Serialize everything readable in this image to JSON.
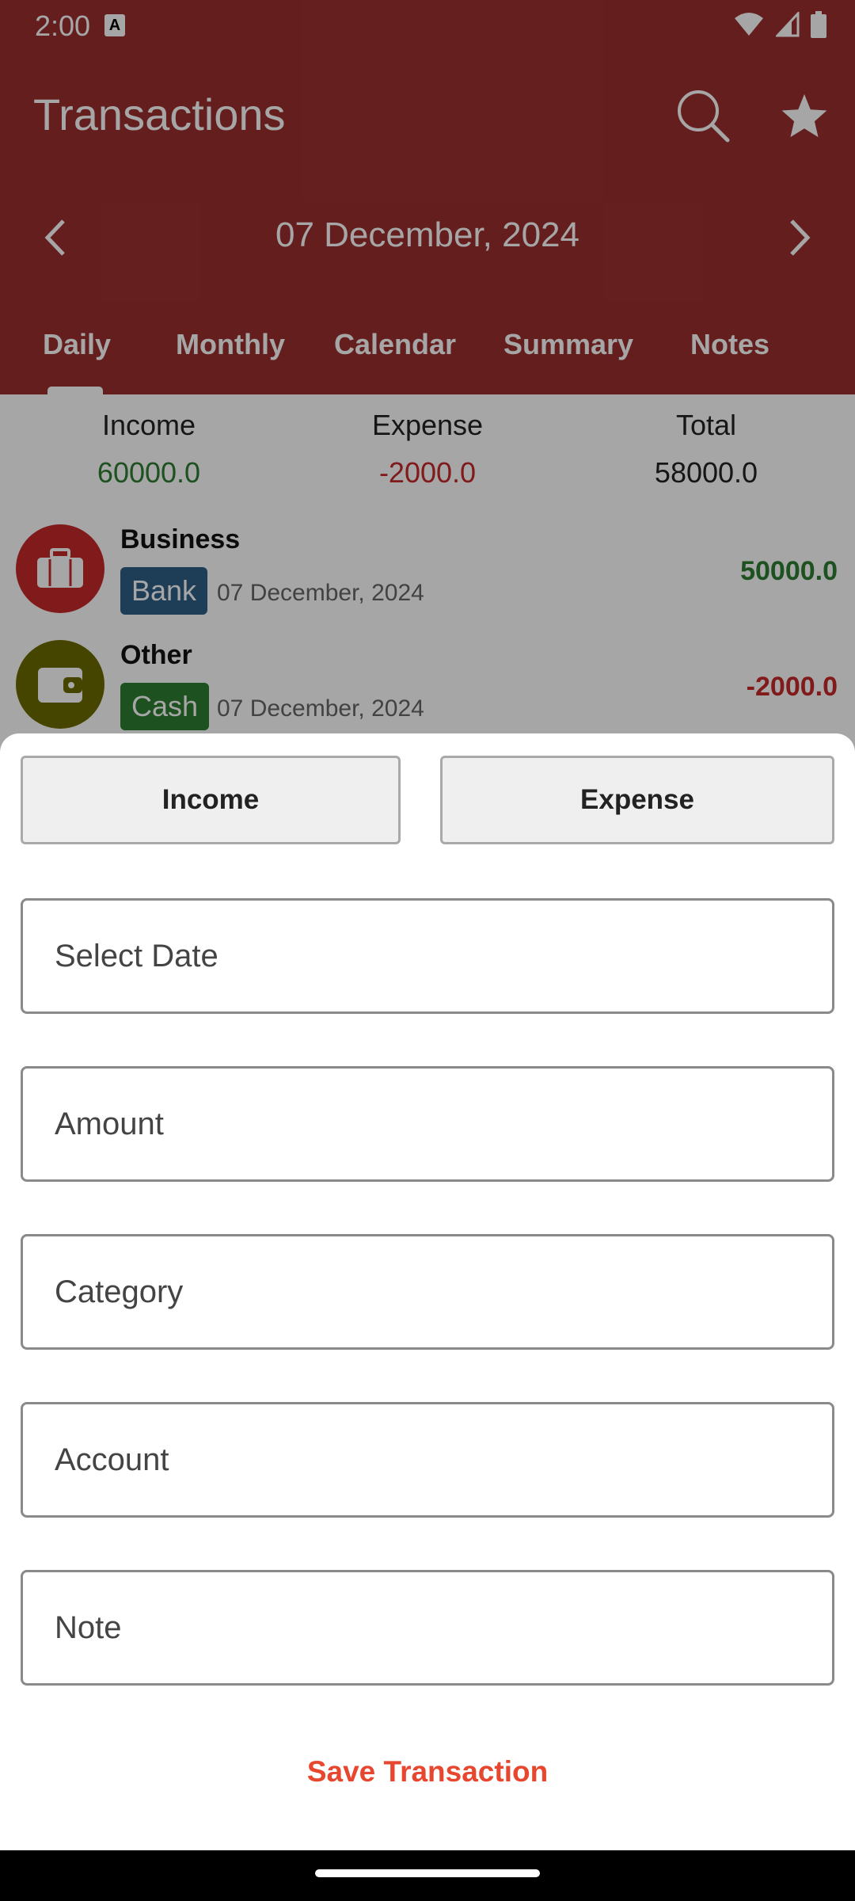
{
  "status_bar": {
    "time": "2:00",
    "notification_icon": "A"
  },
  "app_bar": {
    "title": "Transactions",
    "search_icon": "search-icon",
    "favorite_icon": "star-icon",
    "current_date": "07 December, 2024"
  },
  "tabs": [
    "Daily",
    "Monthly",
    "Calendar",
    "Summary",
    "Notes"
  ],
  "summary": {
    "income_label": "Income",
    "income_value": "60000.0",
    "expense_label": "Expense",
    "expense_value": "-2000.0",
    "total_label": "Total",
    "total_value": "58000.0"
  },
  "transactions": [
    {
      "name": "Business",
      "account": "Bank",
      "date": "07 December, 2024",
      "amount": "50000.0",
      "icon": "briefcase-icon",
      "color": "#c62828",
      "account_color": "#2f5f86",
      "amount_color": "#2e7d32"
    },
    {
      "name": "Other",
      "account": "Cash",
      "date": "07 December, 2024",
      "amount": "-2000.0",
      "icon": "wallet-icon",
      "color": "#6b6b00",
      "account_color": "#2e7d32",
      "amount_color": "#c62828"
    }
  ],
  "sheet": {
    "income_button": "Income",
    "expense_button": "Expense",
    "date_placeholder": "Select Date",
    "amount_placeholder": "Amount",
    "category_placeholder": "Category",
    "account_placeholder": "Account",
    "note_placeholder": "Note",
    "save_button": "Save Transaction"
  },
  "colors": {
    "primary": "#9b2f2f",
    "income": "#2e7d32",
    "expense": "#c62828",
    "accent": "#e8472f"
  }
}
